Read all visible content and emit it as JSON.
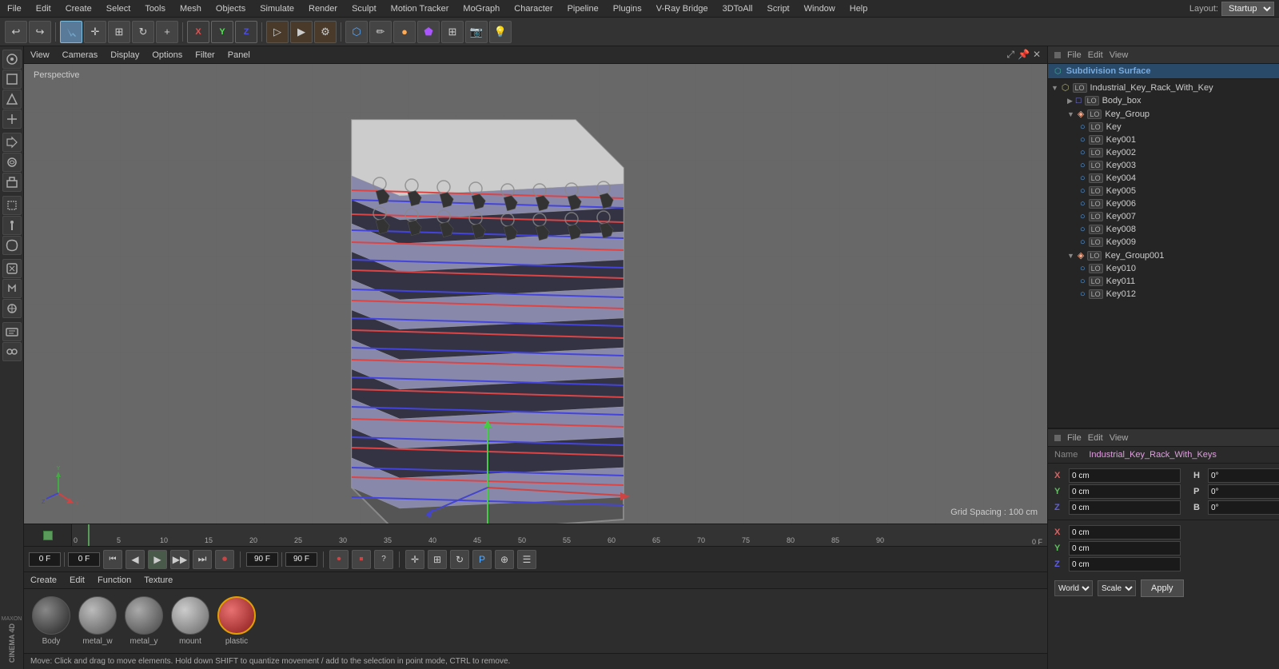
{
  "app": {
    "title": "Cinema 4D",
    "layout_label": "Layout:",
    "layout_value": "Startup"
  },
  "menu": {
    "items": [
      "File",
      "Edit",
      "Create",
      "Select",
      "Tools",
      "Mesh",
      "Objects",
      "Simulate",
      "Render",
      "Sculpt",
      "Motion Tracker",
      "MoGraph",
      "Character",
      "Pipeline",
      "Plugins",
      "V-Ray Bridge",
      "3DToAll",
      "Script",
      "Window",
      "Help"
    ]
  },
  "viewport": {
    "perspective_label": "Perspective",
    "grid_spacing": "Grid Spacing : 100 cm",
    "header_items": [
      "View",
      "Cameras",
      "Display",
      "Options",
      "Filter",
      "Panel"
    ]
  },
  "timeline": {
    "ticks": [
      "0",
      "5",
      "10",
      "15",
      "20",
      "25",
      "30",
      "35",
      "40",
      "45",
      "50",
      "55",
      "60",
      "65",
      "70",
      "75",
      "80",
      "85",
      "90"
    ],
    "frame_label": "0 F",
    "end_frame": "90 F",
    "current_frame_input": "0 F",
    "start_input": "0 F"
  },
  "transport": {
    "frame_display": "0 F",
    "start_frame": "0 F",
    "end_frame": "90 F",
    "end_frame2": "90 F"
  },
  "scene_tree": {
    "top_panel_title_items": [
      "File",
      "Edit",
      "View"
    ],
    "subdivision_label": "Subdivision Surface",
    "items": [
      {
        "id": "industrial_key_rack",
        "label": "Industrial_Key_Rack_With_Key",
        "indent": 1,
        "has_arrow": false,
        "type": "object"
      },
      {
        "id": "body_box",
        "label": "Body_box",
        "indent": 2,
        "has_arrow": false,
        "type": "box"
      },
      {
        "id": "key_group",
        "label": "Key_Group",
        "indent": 2,
        "has_arrow": true,
        "type": "group"
      },
      {
        "id": "key",
        "label": "Key",
        "indent": 3,
        "has_arrow": false,
        "type": "object"
      },
      {
        "id": "key001",
        "label": "Key001",
        "indent": 3,
        "has_arrow": false,
        "type": "object"
      },
      {
        "id": "key002",
        "label": "Key002",
        "indent": 3,
        "has_arrow": false,
        "type": "object"
      },
      {
        "id": "key003",
        "label": "Key003",
        "indent": 3,
        "has_arrow": false,
        "type": "object"
      },
      {
        "id": "key004",
        "label": "Key004",
        "indent": 3,
        "has_arrow": false,
        "type": "object"
      },
      {
        "id": "key005",
        "label": "Key005",
        "indent": 3,
        "has_arrow": false,
        "type": "object"
      },
      {
        "id": "key006",
        "label": "Key006",
        "indent": 3,
        "has_arrow": false,
        "type": "object"
      },
      {
        "id": "key007",
        "label": "Key007",
        "indent": 3,
        "has_arrow": false,
        "type": "object"
      },
      {
        "id": "key008",
        "label": "Key008",
        "indent": 3,
        "has_arrow": false,
        "type": "object"
      },
      {
        "id": "key009",
        "label": "Key009",
        "indent": 3,
        "has_arrow": false,
        "type": "object"
      },
      {
        "id": "key_group001",
        "label": "Key_Group001",
        "indent": 2,
        "has_arrow": true,
        "type": "group"
      },
      {
        "id": "key010",
        "label": "Key010",
        "indent": 3,
        "has_arrow": false,
        "type": "object"
      },
      {
        "id": "key011",
        "label": "Key011",
        "indent": 3,
        "has_arrow": false,
        "type": "object"
      },
      {
        "id": "key012",
        "label": "Key012",
        "indent": 3,
        "has_arrow": false,
        "type": "object"
      }
    ],
    "bottom_panel_title_items": [
      "File",
      "Edit",
      "View"
    ],
    "name_label": "Name",
    "selected_object": "Industrial_Key_Rack_With_Keys"
  },
  "coordinates": {
    "position": {
      "x_label": "X",
      "x_val": "0 cm",
      "y_label": "Y",
      "y_val": "0 cm",
      "z_label": "Z",
      "z_val": "0 cm"
    },
    "rotation": {
      "h_label": "H",
      "h_val": "0°",
      "p_label": "P",
      "p_val": "0°",
      "b_label": "B",
      "b_val": "0°"
    },
    "size": {
      "x_label": "X",
      "x_val": "0 cm",
      "y_label": "Y",
      "y_val": "0 cm",
      "z_label": "Z",
      "z_val": "0 cm"
    },
    "world_select": "World",
    "scale_select": "Scale",
    "apply_btn": "Apply"
  },
  "materials": {
    "header_items": [
      "Create",
      "Edit",
      "Function",
      "Texture"
    ],
    "swatches": [
      {
        "id": "body",
        "label": "Body",
        "type": "body"
      },
      {
        "id": "metal_w",
        "label": "metal_w",
        "type": "metal1"
      },
      {
        "id": "metal_y",
        "label": "metal_y",
        "type": "metal2"
      },
      {
        "id": "mount",
        "label": "mount",
        "type": "mount"
      },
      {
        "id": "plastic",
        "label": "plastic",
        "type": "plastic"
      }
    ]
  },
  "status_bar": {
    "text": "Move: Click and drag to move elements. Hold down SHIFT to quantize movement / add to the selection in point mode, CTRL to remove."
  },
  "icons": {
    "undo": "↩",
    "redo": "↪",
    "arrow": "↖",
    "move": "✛",
    "scale": "⊞",
    "rotate": "↻",
    "add": "+",
    "x_axis": "X",
    "y_axis": "Y",
    "z_axis": "Z",
    "cube_wire": "⬡",
    "pen": "✏",
    "sphere": "●",
    "gear": "⚙",
    "camera": "📷",
    "light": "💡",
    "play": "▶",
    "prev": "⏮",
    "prev_frame": "◀",
    "next_frame": "▶",
    "next": "⏭",
    "record": "⏺",
    "loop": "🔁"
  }
}
